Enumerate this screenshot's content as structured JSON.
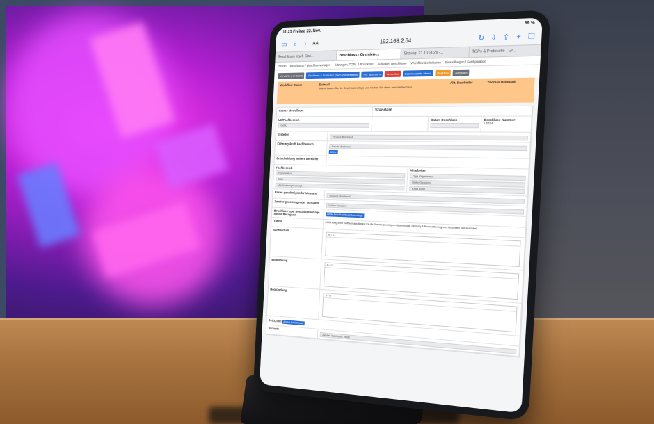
{
  "status_bar": {
    "time": "11:21",
    "date": "Freitag 22. Nov.",
    "battery": "69 %"
  },
  "browser": {
    "text_size": "AA",
    "url": "192.168.2.64"
  },
  "tabs": [
    {
      "label": "Beschlüsse nach Stat..."
    },
    {
      "label": "Beschluss - Gremien-..."
    },
    {
      "label": "Sitzung: 21.10.2024 -..."
    },
    {
      "label": "TOPs & Protokolle - Gr..."
    }
  ],
  "nav_items": [
    "Entdki",
    "Beschlüsse / Beschlussvorlagen",
    "Sitzungen, TOPs & Protokolle",
    "Aufgaben Beschlüsse",
    "Workflow-Definitionen",
    "Einstellungen / Konfiguration"
  ],
  "toolbar": {
    "buttons": [
      {
        "label": "Vorwärtsr (nur Sicht)",
        "style": "grey"
      },
      {
        "label": "Speichern & Schließen (nach Vorbereitung)",
        "style": "blue"
      },
      {
        "label": "Nur Speichern",
        "style": "blue"
      },
      {
        "label": "Verwerfen",
        "style": "red"
      },
      {
        "label": "Beschlussakte öffnen",
        "style": "blue"
      },
      {
        "label": "Workflow",
        "style": "orange"
      },
      {
        "label": "Aufgaben",
        "style": "grey"
      }
    ]
  },
  "workflow": {
    "status_label": "Workflow-Status",
    "status_value": "Entwurf",
    "description": "Bitte erfassen Sie die Beschlussvorlage und reichen Sie diese anschließend ein",
    "editor_label": "Akt. Bearbeiter",
    "editor_value": "Thomas Reinhardt"
  },
  "form": {
    "brand": "Gremo-Modellbure",
    "template_value": "Standard",
    "unit_label": "UE/Fachbereich",
    "unit_value": "GeFÜ",
    "date_label": "Datum Beschluss",
    "number_label": "Beschluss-Nummer",
    "number_value": "/ 2024",
    "creator_label": "Ersteller",
    "creator_value": "Thomas Reinhardt",
    "lead_label": "Führungskraft Fachbereich",
    "lead_value": "Rainer Wallmann",
    "decision_label": "Entscheidung weitere Bereiche",
    "section_dept": "Fachbereich",
    "section_staff": "Mitarbeiter",
    "org_label": "Organisation",
    "org_staff": "Olga Organisator",
    "dsb_label": "DSB",
    "dsb_staff": "Dieter Schützer",
    "ins_label": "Versicherungskonzept",
    "ins_staff": "Katja Rose",
    "board1_label": "Erster genehmigender Vorstand",
    "board1_value": "Thomas Reinhardt",
    "board2_label": "Zweiter genehmigender Vorstand",
    "board2_value": "Volker Vorstand",
    "reference_label": "Beschluss bzw. Beschlussvorlage nimmt Bezug auf",
    "reference_button": "Wähle Beschluss/Beschlussvorlage",
    "topic_label": "Thema",
    "topic_value": "Einführung einer Softwareapplikation für die Beschlussvorlagen-Bearbeitung, Planung & Protokollierung von Sitzungen und anschließ",
    "fact_label": "Sachverhalt",
    "rec_label": "Empfehlung",
    "reason_label": "Begründung",
    "date_row_label": "Jetzt, den",
    "change_button": "Andere Beschlussart",
    "variant_label": "Variante",
    "variant_value": "Zweiter Schlüssel: Teste",
    "choose_label": "Wähle"
  },
  "editor_toolbar": "B I U",
  "colors": {
    "accent": "#2a6fd6",
    "banner": "#ffc689"
  }
}
